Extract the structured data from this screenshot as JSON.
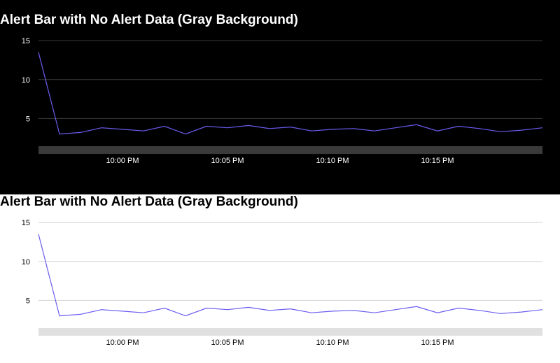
{
  "theme": {
    "dark": {
      "background": "#000000",
      "text": "#ffffff",
      "grid": "#3a3a3a",
      "alert_bar": "#3a3a3a",
      "line": "#6b5cf0"
    },
    "light": {
      "background": "#ffffff",
      "text": "#000000",
      "grid": "#d0d0d0",
      "alert_bar": "#e0e0e0",
      "line": "#6b5cf0"
    }
  },
  "chart_data": [
    {
      "theme": "dark",
      "type": "line",
      "title": "Alert Bar with No Alert Data (Gray Background)",
      "xlabel": "",
      "ylabel": "",
      "ylim": [
        0,
        16
      ],
      "y_ticks": [
        5,
        10,
        15
      ],
      "x_ticks": [
        "10:00 PM",
        "10:05 PM",
        "10:10 PM",
        "10:15 PM"
      ],
      "x_tick_positions_min": [
        4,
        9,
        14,
        19
      ],
      "x_range_min": [
        0,
        24
      ],
      "grid": true,
      "alert_bar": "no alert data (gray)",
      "series": [
        {
          "x": [
            0,
            1,
            2,
            3,
            4,
            5,
            6,
            7,
            8,
            9,
            10,
            11,
            12,
            13,
            14,
            15,
            16,
            17,
            18,
            19,
            20,
            21,
            22,
            23,
            24
          ],
          "values": [
            13.5,
            3.0,
            3.2,
            3.8,
            3.6,
            3.4,
            4.0,
            3.0,
            4.0,
            3.8,
            4.1,
            3.7,
            3.9,
            3.4,
            3.6,
            3.7,
            3.4,
            3.8,
            4.2,
            3.4,
            4.0,
            3.7,
            3.3,
            3.5,
            3.8
          ]
        }
      ]
    },
    {
      "theme": "light",
      "type": "line",
      "title": "Alert Bar with No Alert Data (Gray Background)",
      "xlabel": "",
      "ylabel": "",
      "ylim": [
        0,
        16
      ],
      "y_ticks": [
        5,
        10,
        15
      ],
      "x_ticks": [
        "10:00 PM",
        "10:05 PM",
        "10:10 PM",
        "10:15 PM"
      ],
      "x_tick_positions_min": [
        4,
        9,
        14,
        19
      ],
      "x_range_min": [
        0,
        24
      ],
      "grid": true,
      "alert_bar": "no alert data (gray)",
      "series": [
        {
          "x": [
            0,
            1,
            2,
            3,
            4,
            5,
            6,
            7,
            8,
            9,
            10,
            11,
            12,
            13,
            14,
            15,
            16,
            17,
            18,
            19,
            20,
            21,
            22,
            23,
            24
          ],
          "values": [
            13.5,
            3.0,
            3.2,
            3.8,
            3.6,
            3.4,
            4.0,
            3.0,
            4.0,
            3.8,
            4.1,
            3.7,
            3.9,
            3.4,
            3.6,
            3.7,
            3.4,
            3.8,
            4.2,
            3.4,
            4.0,
            3.7,
            3.3,
            3.5,
            3.8
          ]
        }
      ]
    }
  ]
}
